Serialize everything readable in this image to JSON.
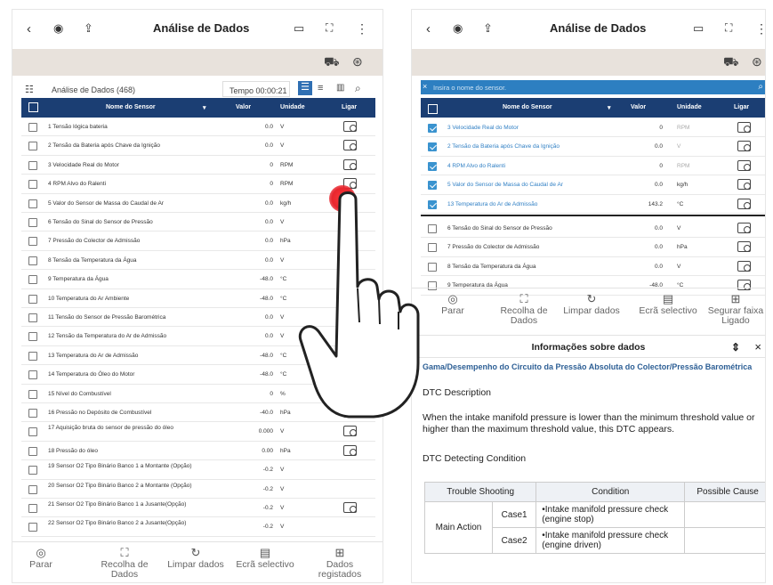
{
  "left": {
    "title": "Análise de Dados",
    "list_title": "Análise de Dados (468)",
    "timer": "Tempo 00:00:21",
    "columns": {
      "name": "Nome do Sensor",
      "value": "Valor",
      "unit": "Unidade",
      "link": "Ligar"
    },
    "rows": [
      {
        "name": "1 Tensão lógica bateria",
        "value": "0.0",
        "unit": "V",
        "icon": true
      },
      {
        "name": "2 Tensão da Bateria após Chave da Ignição",
        "value": "0.0",
        "unit": "V",
        "icon": true
      },
      {
        "name": "3 Velocidade Real do Motor",
        "value": "0",
        "unit": "RPM",
        "icon": true
      },
      {
        "name": "4 RPM Alvo do Ralenti",
        "value": "0",
        "unit": "RPM",
        "icon": true
      },
      {
        "name": "5 Valor do Sensor de Massa do Caudal de Ar",
        "value": "0.0",
        "unit": "kg/h",
        "icon": false
      },
      {
        "name": "6 Tensão do Sinal do Sensor de Pressão",
        "value": "0.0",
        "unit": "V",
        "icon": false
      },
      {
        "name": "7 Pressão do Colector de Admissão",
        "value": "0.0",
        "unit": "hPa",
        "icon": false
      },
      {
        "name": "8 Tensão da Temperatura da Água",
        "value": "0.0",
        "unit": "V",
        "icon": false
      },
      {
        "name": "9 Temperatura da Água",
        "value": "-48.0",
        "unit": "°C",
        "icon": false
      },
      {
        "name": "10 Temperatura do Ar Ambiente",
        "value": "-48.0",
        "unit": "°C",
        "icon": false
      },
      {
        "name": "11 Tensão do Sensor de Pressão Barométrica",
        "value": "0.0",
        "unit": "V",
        "icon": false
      },
      {
        "name": "12 Tensão da Temperatura do Ar de Admissão",
        "value": "0.0",
        "unit": "V",
        "icon": false
      },
      {
        "name": "13 Temperatura do Ar de Admissão",
        "value": "-48.0",
        "unit": "°C",
        "icon": false
      },
      {
        "name": "14 Temperatura do Óleo do Motor",
        "value": "-48.0",
        "unit": "°C",
        "icon": false
      },
      {
        "name": "15 Nível do Combustível",
        "value": "0",
        "unit": "%",
        "icon": false
      },
      {
        "name": "16 Pressão no Depósito de Combustível",
        "value": "-40.0",
        "unit": "hPa",
        "icon": true
      },
      {
        "name": "17 Aquisição bruta do sensor de pressão do óleo",
        "value": "0.000",
        "unit": "V",
        "icon": true
      },
      {
        "name": "18 Pressão do óleo",
        "value": "0.00",
        "unit": "hPa",
        "icon": true
      },
      {
        "name": "19 Sensor O2 Tipo Binário Banco 1 a Montante (Opção)",
        "value": "-0.2",
        "unit": "V",
        "icon": false
      },
      {
        "name": "20 Sensor O2 Tipo Binário Banco 2 a Montante (Opção)",
        "value": "-0.2",
        "unit": "V",
        "icon": false
      },
      {
        "name": "21 Sensor O2 Tipo Binário Banco 1 a Jusante(Opção)",
        "value": "-0.2",
        "unit": "V",
        "icon": true
      },
      {
        "name": "22 Sensor O2 Tipo Binário Banco 2 a Jusante(Opção)",
        "value": "-0.2",
        "unit": "V",
        "icon": false
      }
    ],
    "bottom": [
      {
        "icon": "◎",
        "label": "Parar"
      },
      {
        "icon": "⛶",
        "label": "Recolha de Dados"
      },
      {
        "icon": "↻",
        "label": "Limpar dados"
      },
      {
        "icon": "▤",
        "label": "Ecrã selectivo"
      },
      {
        "icon": "⊞",
        "label": "Dados registados"
      }
    ]
  },
  "right": {
    "title": "Análise de Dados",
    "search_placeholder": "Insira o nome do sensor.",
    "columns": {
      "name": "Nome do Sensor",
      "value": "Valor",
      "unit": "Unidade",
      "link": "Ligar"
    },
    "selected_rows": [
      {
        "name": "3 Velocidade Real do Motor",
        "value": "0",
        "unit": "RPM",
        "faded": true
      },
      {
        "name": "2 Tensão da Bateria após Chave da Ignição",
        "value": "0.0",
        "unit": "V",
        "faded": true
      },
      {
        "name": "4 RPM Alvo do Ralenti",
        "value": "0",
        "unit": "RPM",
        "faded": true
      },
      {
        "name": "5 Valor do Sensor de Massa do Caudal de Ar",
        "value": "0.0",
        "unit": "kg/h",
        "faded": false
      },
      {
        "name": "13 Temperatura do Ar de Admissão",
        "value": "143.2",
        "unit": "°C",
        "faded": false
      }
    ],
    "rows": [
      {
        "name": "6 Tensão do Sinal do Sensor de Pressão",
        "value": "0.0",
        "unit": "V"
      },
      {
        "name": "7 Pressão do Colector de Admissão",
        "value": "0.0",
        "unit": "hPa"
      },
      {
        "name": "8 Tensão da Temperatura da Água",
        "value": "0.0",
        "unit": "V"
      },
      {
        "name": "9 Temperatura da Água",
        "value": "-48.0",
        "unit": "°C"
      }
    ],
    "bottom": [
      {
        "icon": "◎",
        "label": "Parar"
      },
      {
        "icon": "⛶",
        "label": "Recolha de Dados"
      },
      {
        "icon": "↻",
        "label": "Limpar dados"
      },
      {
        "icon": "▤",
        "label": "Ecrã selectivo"
      },
      {
        "icon": "⊞",
        "label": "Segurar faixa Ligado"
      }
    ],
    "info": {
      "title": "Informações sobre dados",
      "dtc_title": "Gama/Desempenho do Circuito da Pressão Absoluta do Colector/Pressão Barométrica",
      "desc_heading": "DTC Description",
      "desc_text": "When the intake manifold pressure is lower than the minimum threshold value or higher than the maximum threshold value, this DTC appears.",
      "cond_heading": "DTC Detecting Condition",
      "table_headers": [
        "Trouble Shooting",
        "Condition",
        "Possible Cause"
      ],
      "main_action": "Main Action",
      "cases": [
        {
          "case": "Case1",
          "condition": "•Intake manifold pressure check (engine stop)"
        },
        {
          "case": "Case2",
          "condition": "•Intake manifold pressure check (engine driven)"
        }
      ]
    }
  },
  "colors": {
    "header": "#1b3e73",
    "accent": "#2d7fc1",
    "touch": "#e8262e"
  }
}
